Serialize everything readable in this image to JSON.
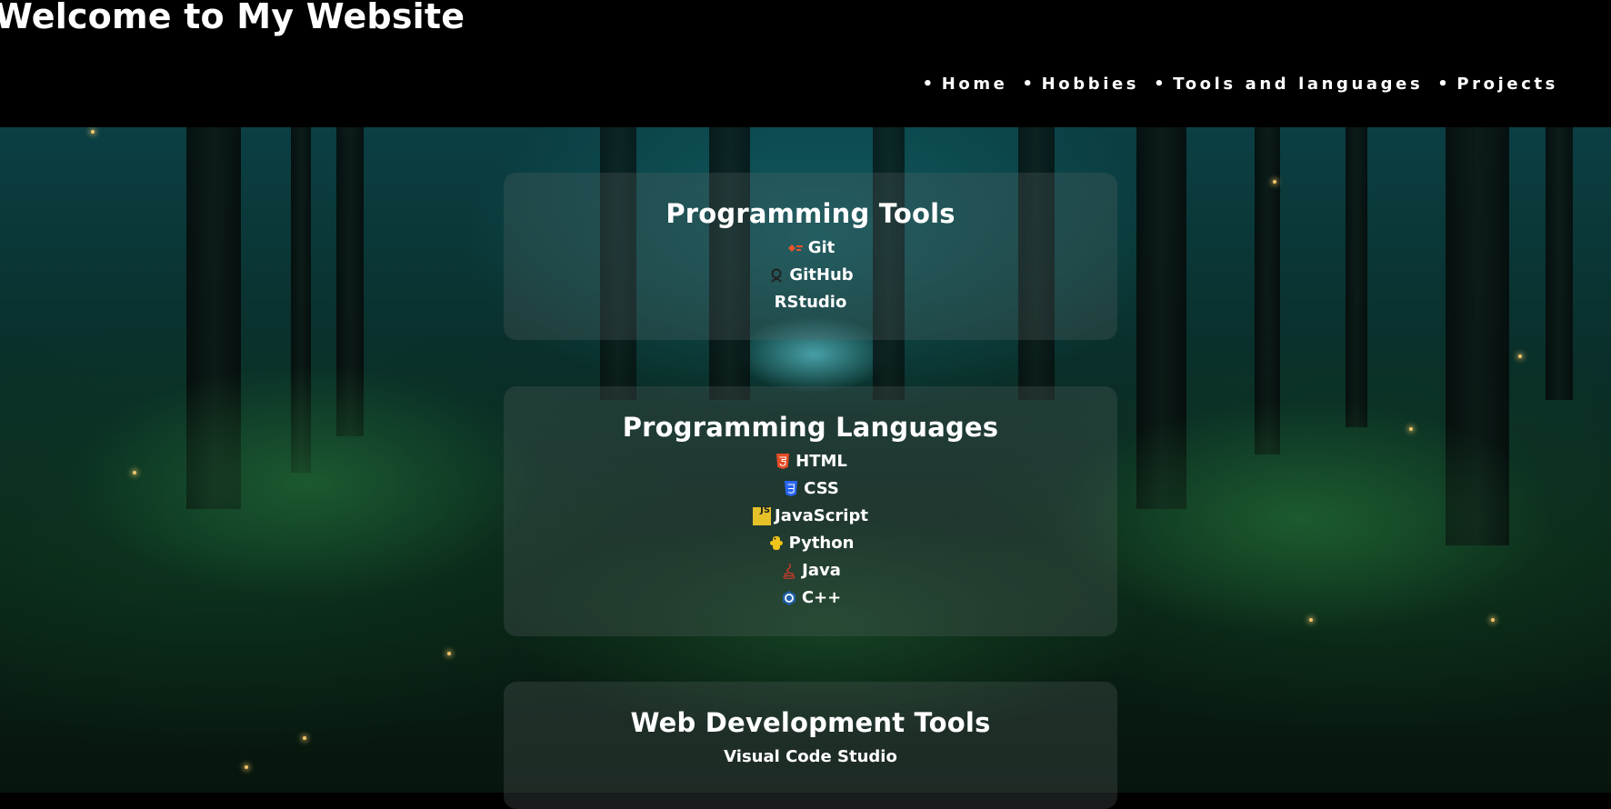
{
  "header": {
    "title": "Welcome to My Website",
    "nav": [
      {
        "label": "Home"
      },
      {
        "label": "Hobbies"
      },
      {
        "label": "Tools and languages"
      },
      {
        "label": "Projects"
      }
    ],
    "bullet": "•"
  },
  "sections": {
    "tools": {
      "title": "Programming Tools",
      "items": [
        {
          "label": "Git",
          "icon": "git-icon"
        },
        {
          "label": "GitHub",
          "icon": "github-icon"
        },
        {
          "label": "RStudio",
          "icon": ""
        }
      ]
    },
    "languages": {
      "title": "Programming Languages",
      "items": [
        {
          "label": "HTML",
          "icon": "html5-icon"
        },
        {
          "label": "CSS",
          "icon": "css3-icon"
        },
        {
          "label": "JavaScript",
          "icon": "javascript-icon",
          "icon_text": "JS"
        },
        {
          "label": "Python",
          "icon": "python-icon"
        },
        {
          "label": "Java",
          "icon": "java-icon"
        },
        {
          "label": "C++",
          "icon": "cplusplus-icon"
        }
      ]
    },
    "webdev": {
      "title": "Web Development Tools",
      "items": [
        {
          "label": "Visual Code Studio",
          "icon": ""
        }
      ]
    }
  },
  "colors": {
    "background": "#000000",
    "text": "#ffffff",
    "git": "#e8552d",
    "html": "#e44d26",
    "css": "#2965f1",
    "javascript": "#e6c229",
    "python": "#f0c419",
    "java": "#c0392b",
    "cpp": "#1f5fa8"
  }
}
